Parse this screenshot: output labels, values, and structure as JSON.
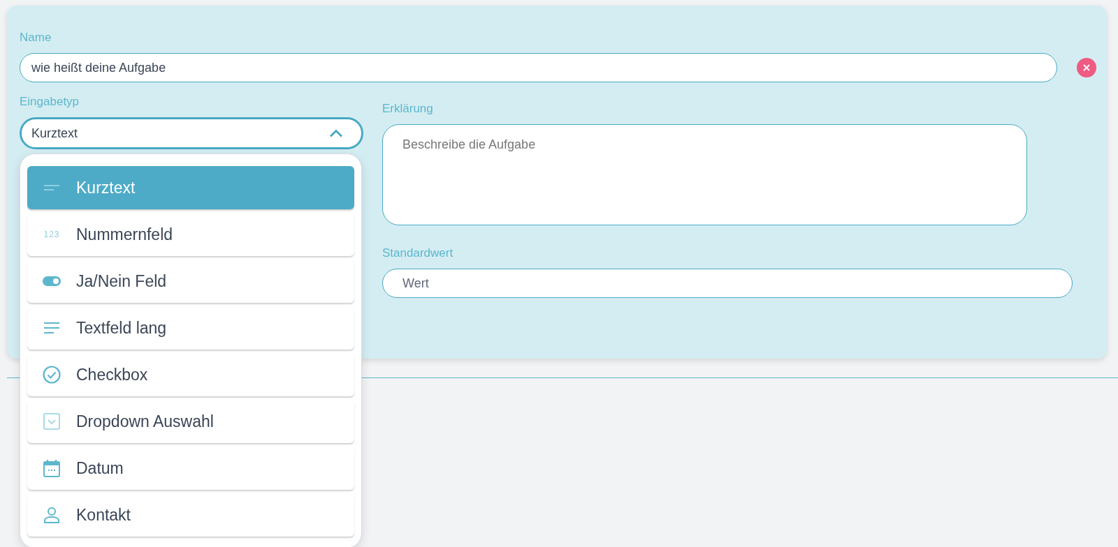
{
  "name_field": {
    "label": "Name",
    "value": "wie heißt deine Aufgabe"
  },
  "input_type": {
    "label": "Eingabetyp",
    "value": "Kurztext",
    "expanded": true,
    "options": [
      {
        "kind": "short-text",
        "label": "Kurztext",
        "selected": true
      },
      {
        "kind": "number",
        "icon_text": "123",
        "label": "Nummernfeld",
        "selected": false
      },
      {
        "kind": "toggle",
        "label": "Ja/Nein Feld",
        "selected": false
      },
      {
        "kind": "long-text",
        "label": "Textfeld lang",
        "selected": false
      },
      {
        "kind": "checkbox",
        "label": "Checkbox",
        "selected": false
      },
      {
        "kind": "dropdown",
        "label": "Dropdown Auswahl",
        "selected": false
      },
      {
        "kind": "date",
        "label": "Datum",
        "selected": false
      },
      {
        "kind": "contact",
        "label": "Kontakt",
        "selected": false
      }
    ]
  },
  "description": {
    "label": "Erklärung",
    "placeholder": "Beschreibe die Aufgabe"
  },
  "default_value": {
    "label": "Standardwert",
    "placeholder": "Wert"
  }
}
